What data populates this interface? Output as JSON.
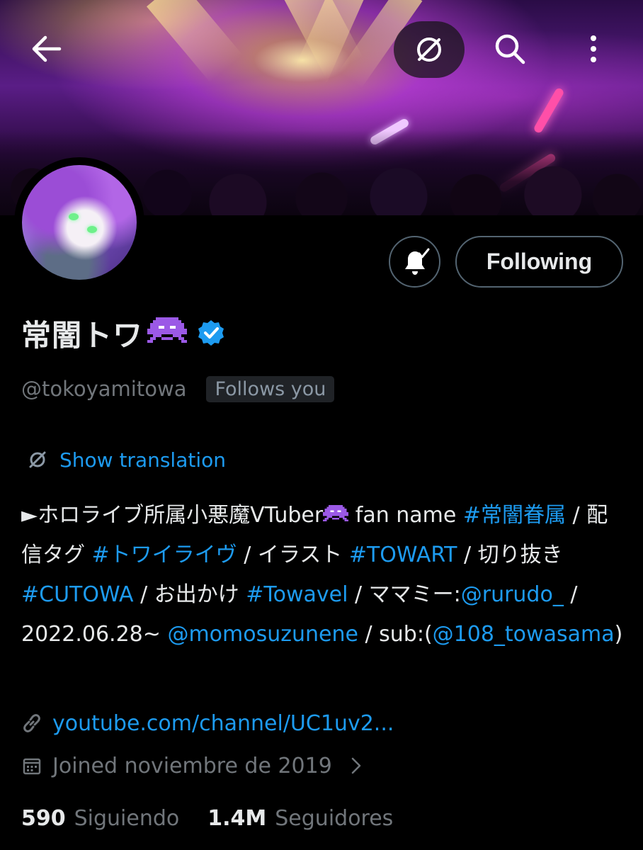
{
  "header": {
    "back_icon": "arrow-left-icon",
    "translate_icon": "globe-off-icon",
    "search_icon": "search-icon",
    "more_icon": "more-vertical-icon",
    "banner_description_colors": {
      "stage": "#5a1d86",
      "light": "#ffe9aa",
      "glowstick": "#ff4fa8"
    }
  },
  "profile": {
    "display_name": "常闇トワ",
    "name_emoji": "space-invader-icon",
    "verified": true,
    "handle": "@tokoyamitowa",
    "follows_you": "Follows you",
    "notify_icon": "bell-check-icon",
    "following_label": "Following"
  },
  "translation": {
    "label": "Show translation"
  },
  "bio": {
    "p1": "►ホロライブ所属小悪魔VTuber",
    "p2": " fan name ",
    "tag1": "#常闇眷属",
    "p3": " / 配信タグ ",
    "tag2": "#トワイライヴ",
    "p4": " / イラスト ",
    "tag3": "#TOWART",
    "p5": " / 切り抜き ",
    "tag4": "#CUTOWA",
    "p6": " / お出かけ ",
    "tag5": "#Towavel",
    "p7": " / ママミー:",
    "mention1": "@rurudo_",
    "p8": " / 2022.06.28~ ",
    "mention2": "@momosuzunene",
    "p9": " / sub:(",
    "mention3": "@108_towasama",
    "p10": ")"
  },
  "meta": {
    "link": "youtube.com/channel/UC1uv2...",
    "joined": "Joined noviembre de 2019"
  },
  "stats": {
    "following_count": "590",
    "following_label": "Siguiendo",
    "followers_count": "1.4M",
    "followers_label": "Seguidores"
  },
  "colors": {
    "accent": "#1d9bf0",
    "muted": "#71767b",
    "text": "#e7e9ea",
    "background": "#000000",
    "border": "#536471"
  }
}
